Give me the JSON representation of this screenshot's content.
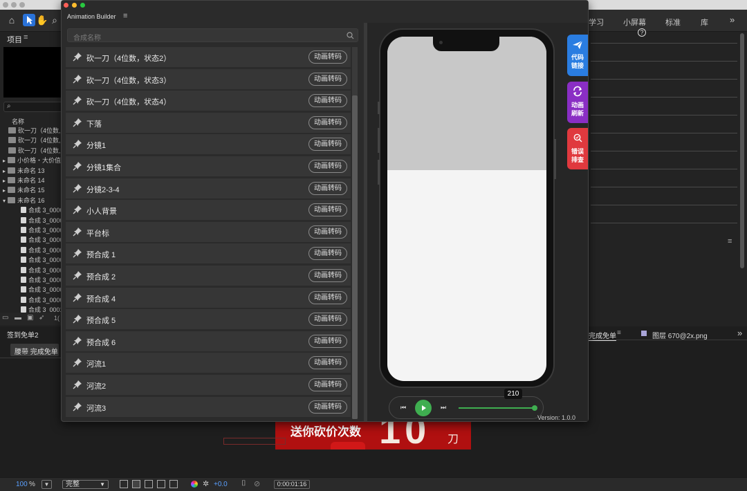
{
  "ae": {
    "workspaces": [
      "学习",
      "小屏幕",
      "标准",
      "库"
    ],
    "project_label": "项目",
    "name_col": "名称",
    "project_items": [
      "砍一刀（4位数,",
      "砍一刀（4位数,",
      "砍一刀（4位数,",
      "小价格・大价值",
      "未命名 13",
      "未命名 14",
      "未命名 15",
      "未命名 16",
      "合成 3_0000",
      "合成 3_0000",
      "合成 3_0000",
      "合成 3_0000",
      "合成 3_0000",
      "合成 3_0000",
      "合成 3_0000",
      "合成 3_0000",
      "合成 3_0000",
      "合成 3_0000",
      "合成 3_0001"
    ],
    "bottom_left_title": "签到免单2",
    "bottom_left_tab": "腰带 完成免单",
    "bottom_right_tab": "完成免单",
    "layer_name": "图层 670@2x.png",
    "preview_text": "送你砍价次数",
    "preview_num": "10",
    "preview_unit": "刀",
    "zoom": "100",
    "zoom_unit": "%",
    "quality": "完整",
    "exposure": "+0.0",
    "timecode": "0:00:01:16",
    "bpc": "1("
  },
  "plugin": {
    "title": "Animation Builder",
    "search_placeholder": "合成名称",
    "convert_label": "动画转码",
    "items": [
      "砍一刀（4位数，状态2）",
      "砍一刀（4位数，状态3）",
      "砍一刀（4位数，状态4）",
      "下落",
      "分镜1",
      "分镜1集合",
      "分镜2-3-4",
      "小人背景",
      "平台标",
      "预合成 1",
      "预合成 2",
      "预合成 4",
      "预合成 5",
      "预合成 6",
      "河流1",
      "河流2",
      "河流3"
    ],
    "side_buttons": [
      {
        "label1": "代码",
        "label2": "链接",
        "color": "#2a7de1"
      },
      {
        "label1": "动画",
        "label2": "刷新",
        "color": "#8a2ec4"
      },
      {
        "label1": "错误",
        "label2": "排查",
        "color": "#e0393e"
      }
    ],
    "frame": "210",
    "version": "Version: 1.0.0",
    "progress": 1.0
  }
}
